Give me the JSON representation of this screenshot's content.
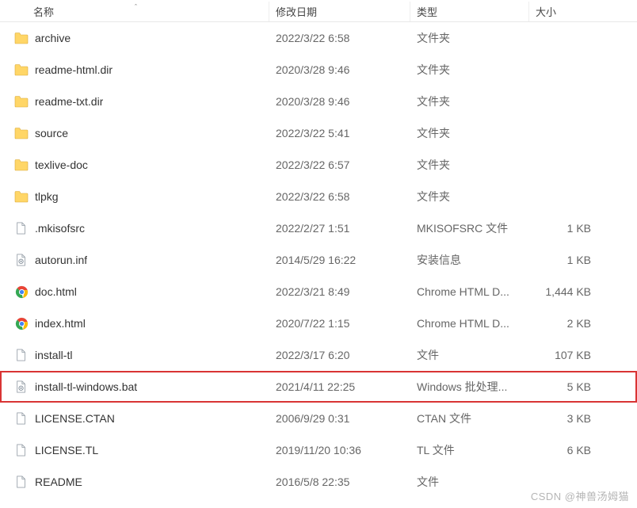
{
  "columns": {
    "name": "名称",
    "date": "修改日期",
    "type": "类型",
    "size": "大小"
  },
  "sort_indicator": "ˆ",
  "files": [
    {
      "icon": "folder",
      "name": "archive",
      "date": "2022/3/22 6:58",
      "type": "文件夹",
      "size": ""
    },
    {
      "icon": "folder",
      "name": "readme-html.dir",
      "date": "2020/3/28 9:46",
      "type": "文件夹",
      "size": ""
    },
    {
      "icon": "folder",
      "name": "readme-txt.dir",
      "date": "2020/3/28 9:46",
      "type": "文件夹",
      "size": ""
    },
    {
      "icon": "folder",
      "name": "source",
      "date": "2022/3/22 5:41",
      "type": "文件夹",
      "size": ""
    },
    {
      "icon": "folder",
      "name": "texlive-doc",
      "date": "2022/3/22 6:57",
      "type": "文件夹",
      "size": ""
    },
    {
      "icon": "folder",
      "name": "tlpkg",
      "date": "2022/3/22 6:58",
      "type": "文件夹",
      "size": ""
    },
    {
      "icon": "file",
      "name": ".mkisofsrc",
      "date": "2022/2/27 1:51",
      "type": "MKISOFSRC 文件",
      "size": "1 KB"
    },
    {
      "icon": "gear",
      "name": "autorun.inf",
      "date": "2014/5/29 16:22",
      "type": "安装信息",
      "size": "1 KB"
    },
    {
      "icon": "chrome",
      "name": "doc.html",
      "date": "2022/3/21 8:49",
      "type": "Chrome HTML D...",
      "size": "1,444 KB"
    },
    {
      "icon": "chrome",
      "name": "index.html",
      "date": "2020/7/22 1:15",
      "type": "Chrome HTML D...",
      "size": "2 KB"
    },
    {
      "icon": "file",
      "name": "install-tl",
      "date": "2022/3/17 6:20",
      "type": "文件",
      "size": "107 KB"
    },
    {
      "icon": "gear",
      "name": "install-tl-windows.bat",
      "date": "2021/4/11 22:25",
      "type": "Windows 批处理...",
      "size": "5 KB",
      "highlighted": true
    },
    {
      "icon": "file",
      "name": "LICENSE.CTAN",
      "date": "2006/9/29 0:31",
      "type": "CTAN 文件",
      "size": "3 KB"
    },
    {
      "icon": "file",
      "name": "LICENSE.TL",
      "date": "2019/11/20 10:36",
      "type": "TL 文件",
      "size": "6 KB"
    },
    {
      "icon": "file",
      "name": "README",
      "date": "2016/5/8 22:35",
      "type": "文件",
      "size": ""
    }
  ],
  "watermark": "CSDN @神兽汤姆猫"
}
